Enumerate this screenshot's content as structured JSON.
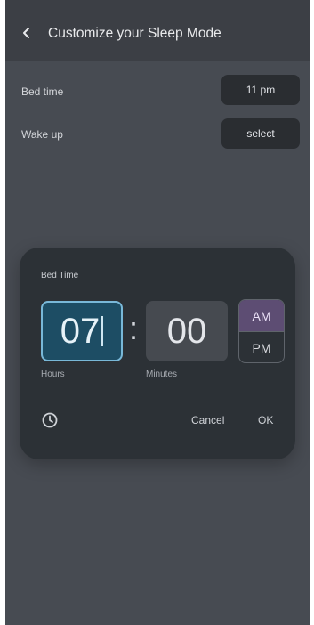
{
  "appbar": {
    "title": "Customize your Sleep Mode",
    "back_icon": "chevron-left-icon"
  },
  "settings": {
    "bed_time": {
      "label": "Bed time",
      "value": "11 pm"
    },
    "wake_up": {
      "label": "Wake up",
      "value": "select"
    }
  },
  "dialog": {
    "title": "Bed Time",
    "hours_value": "07",
    "minutes_value": "00",
    "separator": ":",
    "am_label": "AM",
    "pm_label": "PM",
    "selected_period": "AM",
    "hours_caption": "Hours",
    "minutes_caption": "Minutes",
    "clock_icon": "clock-icon",
    "cancel_label": "Cancel",
    "ok_label": "OK"
  },
  "colors": {
    "screen_bg": "#474b52",
    "dialog_bg": "#2c3136",
    "hours_active_bg": "#1d4d64",
    "hours_active_border": "#79b8d8",
    "am_selected_bg": "#5d4d73"
  }
}
